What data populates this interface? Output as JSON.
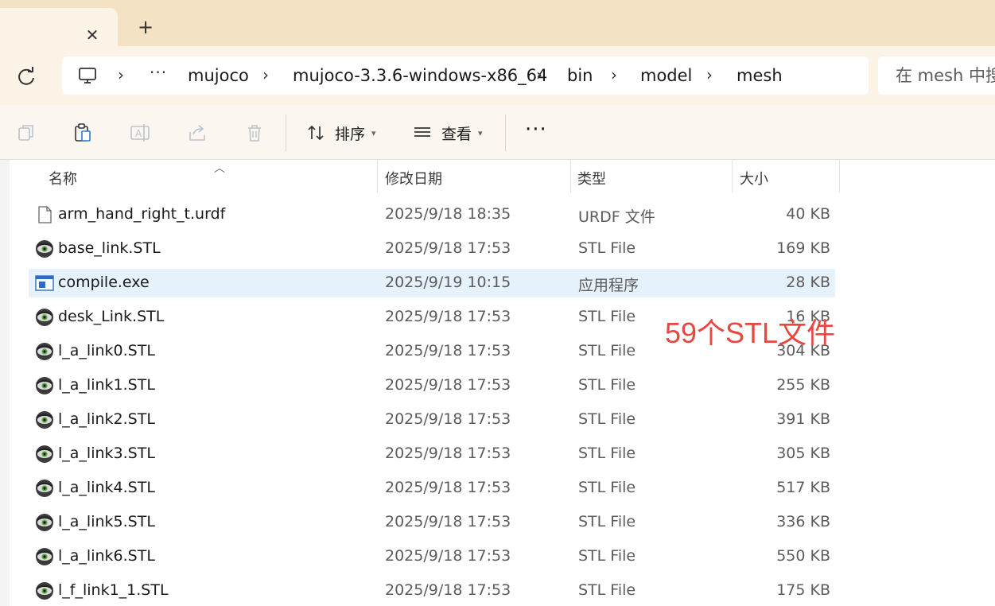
{
  "tabs": {
    "close_symbol": "✕",
    "new_symbol": "+"
  },
  "breadcrumb": {
    "overflow": "···",
    "items": [
      {
        "label": "mujoco"
      },
      {
        "label": "mujoco-3.3.6-windows-x86_64"
      },
      {
        "label": "bin"
      },
      {
        "label": "model"
      },
      {
        "label": "mesh"
      }
    ]
  },
  "search": {
    "placeholder": "在 mesh 中搜"
  },
  "toolbar": {
    "sort_label": "排序",
    "view_label": "查看",
    "more": "···"
  },
  "columns": {
    "name": "名称",
    "modified": "修改日期",
    "type": "类型",
    "size": "大小"
  },
  "files": [
    {
      "name": "arm_hand_right_t.urdf",
      "date": "2025/9/18 18:35",
      "type": "URDF 文件",
      "size": "40 KB",
      "icon": "document-icon"
    },
    {
      "name": "base_link.STL",
      "date": "2025/9/18 17:53",
      "type": "STL File",
      "size": "169 KB",
      "icon": "stl-viewer-icon"
    },
    {
      "name": "compile.exe",
      "date": "2025/9/19 10:15",
      "type": "应用程序",
      "size": "28 KB",
      "icon": "application-icon",
      "selected": true
    },
    {
      "name": "desk_Link.STL",
      "date": "2025/9/18 17:53",
      "type": "STL File",
      "size": "16 KB",
      "icon": "stl-viewer-icon"
    },
    {
      "name": "l_a_link0.STL",
      "date": "2025/9/18 17:53",
      "type": "STL File",
      "size": "304 KB",
      "icon": "stl-viewer-icon"
    },
    {
      "name": "l_a_link1.STL",
      "date": "2025/9/18 17:53",
      "type": "STL File",
      "size": "255 KB",
      "icon": "stl-viewer-icon"
    },
    {
      "name": "l_a_link2.STL",
      "date": "2025/9/18 17:53",
      "type": "STL File",
      "size": "391 KB",
      "icon": "stl-viewer-icon"
    },
    {
      "name": "l_a_link3.STL",
      "date": "2025/9/18 17:53",
      "type": "STL File",
      "size": "305 KB",
      "icon": "stl-viewer-icon"
    },
    {
      "name": "l_a_link4.STL",
      "date": "2025/9/18 17:53",
      "type": "STL File",
      "size": "517 KB",
      "icon": "stl-viewer-icon"
    },
    {
      "name": "l_a_link5.STL",
      "date": "2025/9/18 17:53",
      "type": "STL File",
      "size": "336 KB",
      "icon": "stl-viewer-icon"
    },
    {
      "name": "l_a_link6.STL",
      "date": "2025/9/18 17:53",
      "type": "STL File",
      "size": "550 KB",
      "icon": "stl-viewer-icon"
    },
    {
      "name": "l_f_link1_1.STL",
      "date": "2025/9/18 17:53",
      "type": "STL File",
      "size": "175 KB",
      "icon": "stl-viewer-icon"
    }
  ],
  "annotation": "59个STL文件",
  "colors": {
    "tab_strip": "#f4e2c4",
    "toolbar_bg": "#fbf3e6",
    "selection": "#e5f1fb",
    "annotation": "#e8473f"
  }
}
